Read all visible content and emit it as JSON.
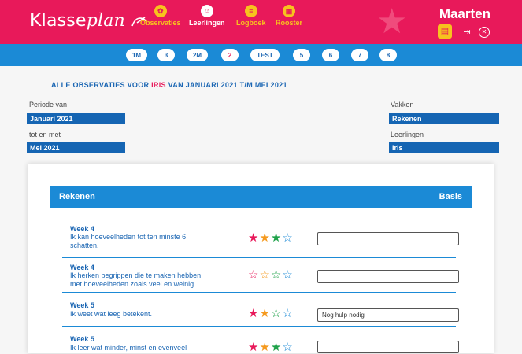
{
  "header": {
    "logo_part1": "Klasse",
    "logo_part2": "plan",
    "nav": [
      {
        "label": "Observaties",
        "icon": "observations-icon",
        "color": "#f7c21e"
      },
      {
        "label": "Leerlingen",
        "icon": "students-icon",
        "color": "#ffffff"
      },
      {
        "label": "Logboek",
        "icon": "logbook-icon",
        "color": "#f7c21e"
      },
      {
        "label": "Rooster",
        "icon": "schedule-icon",
        "color": "#f7c21e"
      }
    ],
    "user": "Maarten",
    "brand_color": "#e8195a"
  },
  "groups": [
    "1M",
    "3",
    "2M",
    "2",
    "TEST",
    "5",
    "6",
    "7",
    "8"
  ],
  "active_group": "2",
  "heading": {
    "prefix": "ALLE OBSERVATIES VOOR",
    "student": "IRIS",
    "suffix": "VAN JANUARI 2021 T/M MEI 2021"
  },
  "filters": {
    "period_from_label": "Periode van",
    "period_from_value": "Januari 2021",
    "period_to_label": "tot en met",
    "period_to_value": "Mei 2021",
    "subjects_label": "Vakken",
    "subjects_value": "Rekenen",
    "students_label": "Leerlingen",
    "students_value": "Iris"
  },
  "card": {
    "subject": "Rekenen",
    "level": "Basis",
    "rows": [
      {
        "week": "Week 4",
        "line1": "Ik kan hoeveelheden tot ten minste 6",
        "line2": "schatten.",
        "stars": 3,
        "note": ""
      },
      {
        "week": "Week 4",
        "line1": "Ik herken begrippen die te maken hebben",
        "line2": "met hoeveelheden zoals veel en weinig.",
        "stars": 0,
        "note": ""
      },
      {
        "week": "Week 5",
        "line1": "Ik weet wat leeg betekent.",
        "line2": "",
        "stars": 2,
        "note": "Nog hulp nodig"
      },
      {
        "week": "Week 5",
        "line1": "Ik leer wat minder, minst en evenveel",
        "line2": "",
        "stars": 3,
        "note": ""
      }
    ],
    "star_colors": [
      "#e8195a",
      "#f59a1e",
      "#1fa24a",
      "#1b8ad6"
    ]
  }
}
